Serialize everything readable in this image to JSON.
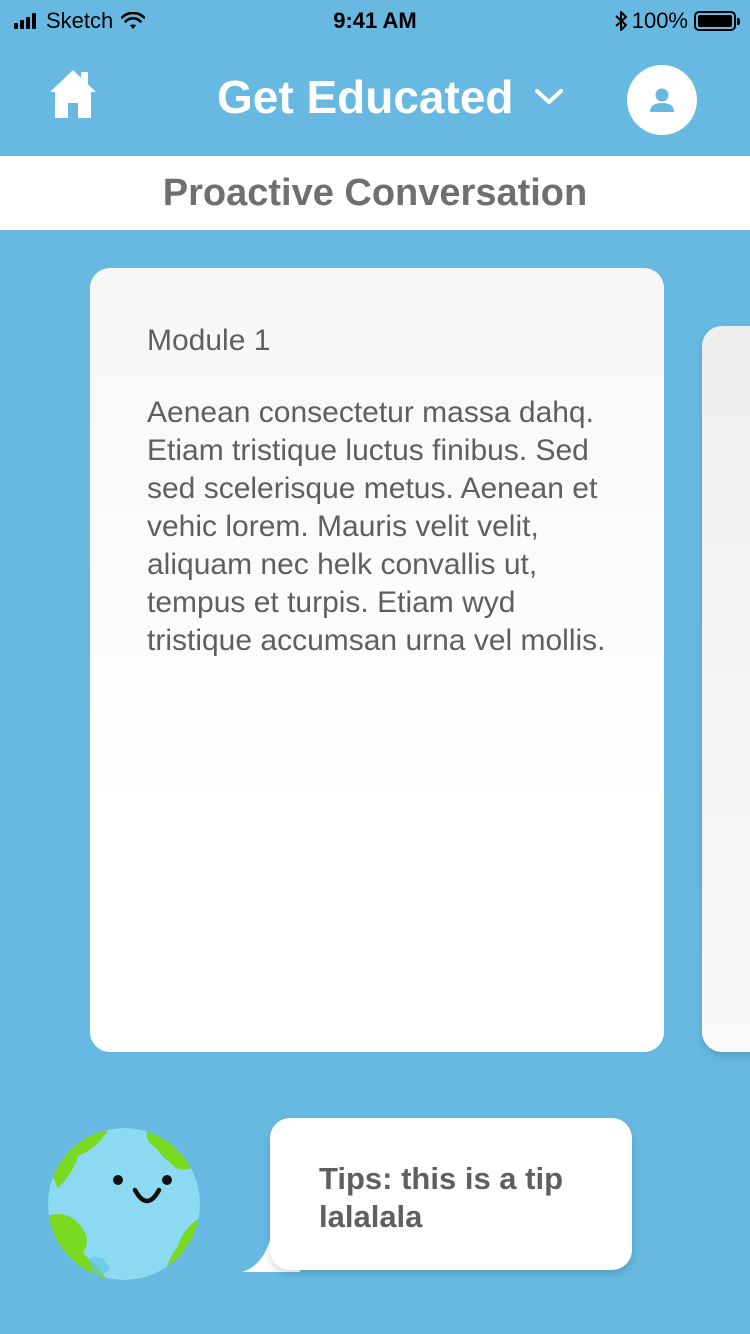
{
  "status_bar": {
    "carrier": "Sketch",
    "time": "9:41 AM",
    "battery": "100%",
    "icons": [
      "signal-icon",
      "wifi-icon",
      "bluetooth-icon",
      "battery-icon"
    ]
  },
  "header": {
    "home_icon": "home-icon",
    "title": "Get Educated",
    "dropdown_icon": "chevron-down-icon",
    "profile_icon": "user-icon"
  },
  "subheader": {
    "title": "Proactive Conversation"
  },
  "cards": [
    {
      "title": "Module 1",
      "body": "Aenean consectetur massa dahq. Etiam tristique luctus finibus. Sed sed scelerisque metus. Aenean et vehic lorem. Mauris velit velit, aliquam nec helk convallis ut, tempus et turpis. Etiam wyd tristique accumsan urna vel mollis."
    }
  ],
  "tips": {
    "mascot_icon": "earth-mascot-icon",
    "text": "Tips: this is a tip lalalala"
  },
  "colors": {
    "background": "#67b9e2",
    "header_text": "#ffffff",
    "body_text": "#5f5f5f",
    "subheader_text": "#6f6f6f",
    "earth_water": "#8cd9f2",
    "earth_land": "#7ad921"
  }
}
